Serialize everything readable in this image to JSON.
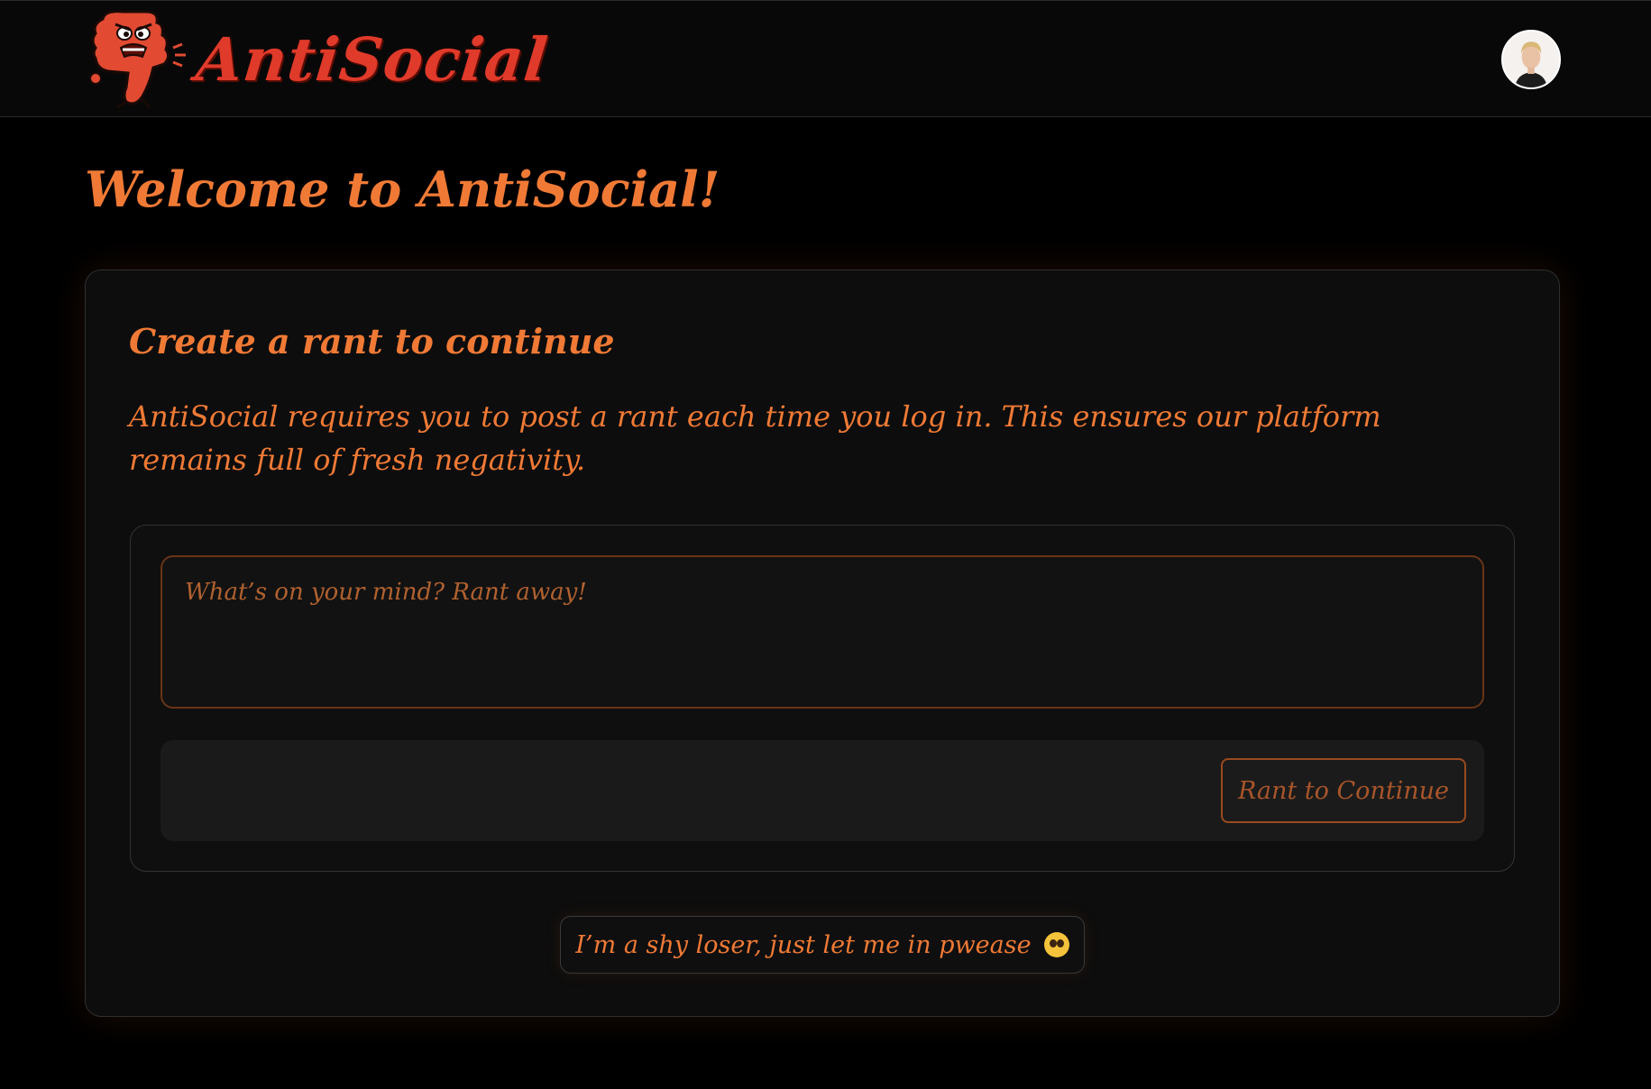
{
  "header": {
    "logo_text": "AntiSocial",
    "logo_icon": "angry-thumbs-down-mascot",
    "avatar_icon": "user-avatar"
  },
  "main": {
    "title": "Welcome to AntiSocial!",
    "card": {
      "heading": "Create a rant to continue",
      "description": "AntiSocial requires you to post a rant each time you log in. This ensures our platform remains full of fresh negativity.",
      "rant_input": {
        "value": "",
        "placeholder": "What’s on your mind? Rant away!"
      },
      "rant_button_label": "Rant to Continue",
      "shy_button_label": "I’m a shy loser, just let me in pwease",
      "shy_button_icon": "pleading-face-emoji"
    }
  },
  "colors": {
    "accent": "#f07a35",
    "logo_red": "#e03a2a",
    "background": "#000000",
    "card_bg": "#0d0d0d"
  }
}
